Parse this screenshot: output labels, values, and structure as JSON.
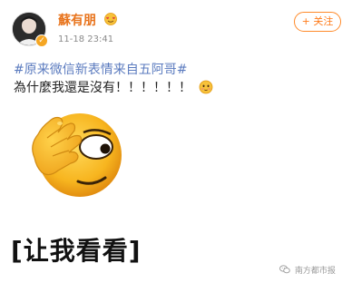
{
  "header": {
    "username": "蘇有朋",
    "vip_badge_icon": "heart-eyes-emoji-icon",
    "verified_icon": "verified-badge-icon",
    "timestamp": "11-18 23:41",
    "follow_label": "+ 关注"
  },
  "post": {
    "hashtag": "#原来微信新表情来自五阿哥#",
    "text": "為什麼我還是沒有！！！！！！",
    "inline_emoji_icon": "smirk-emoji-icon"
  },
  "meme": {
    "image_icon": "face-peeking-through-hand-emoji",
    "caption": "[让我看看]"
  },
  "watermark": {
    "text": "南方都市报",
    "icon": "wechat-icon"
  },
  "colors": {
    "username": "#e8741d",
    "follow_border": "#ff8a2a",
    "hashtag": "#5b7bbf",
    "emoji_yellow": "#f7c23a"
  }
}
